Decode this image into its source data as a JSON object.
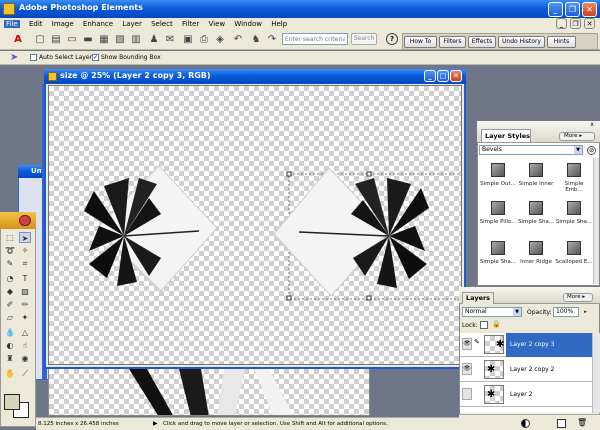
{
  "app": {
    "title": "Adobe Photoshop Elements"
  },
  "menu": [
    "File",
    "Edit",
    "Image",
    "Enhance",
    "Layer",
    "Select",
    "Filter",
    "View",
    "Window",
    "Help"
  ],
  "search": {
    "placeholder": "Enter search criteria",
    "button": "Search"
  },
  "palette_tabs": [
    "How To",
    "Filters",
    "Effects",
    "Undo History",
    "Hints"
  ],
  "options": {
    "auto_select": "Auto Select Layer",
    "bounding_box": "Show Bounding Box"
  },
  "document": {
    "title": "size @ 25% (Layer 2 copy 3, RGB)"
  },
  "background_window": {
    "title": "Unt"
  },
  "layer_styles": {
    "title": "Layer Styles",
    "more": "More",
    "category": "Bevels",
    "items": [
      "Simple Out...",
      "Simple Inner",
      "Simple Emb...",
      "Simple Pillo...",
      "Simple Sha...",
      "Simple Sha...",
      "Simple Sha...",
      "Inner Ridge",
      "Scalloped E..."
    ]
  },
  "layers": {
    "title": "Layers",
    "more": "More",
    "blend_mode": "Normal",
    "opacity_label": "Opacity:",
    "opacity_value": "100%",
    "lock_label": "Lock:",
    "items": [
      {
        "name": "Layer 2 copy 3",
        "selected": true
      },
      {
        "name": "Layer 2 copy 2",
        "selected": false
      },
      {
        "name": "Layer 2",
        "selected": false
      }
    ]
  },
  "status": {
    "size": "8.125 inches x 26.458 inches",
    "hint": "Click and drag to move layer or selection. Use Shift and Alt for additional options."
  },
  "colors": {
    "titlebar": "#0a5bd8",
    "selection": "#316ac5",
    "workspace": "#6f7687",
    "panel": "#ece9d8"
  }
}
